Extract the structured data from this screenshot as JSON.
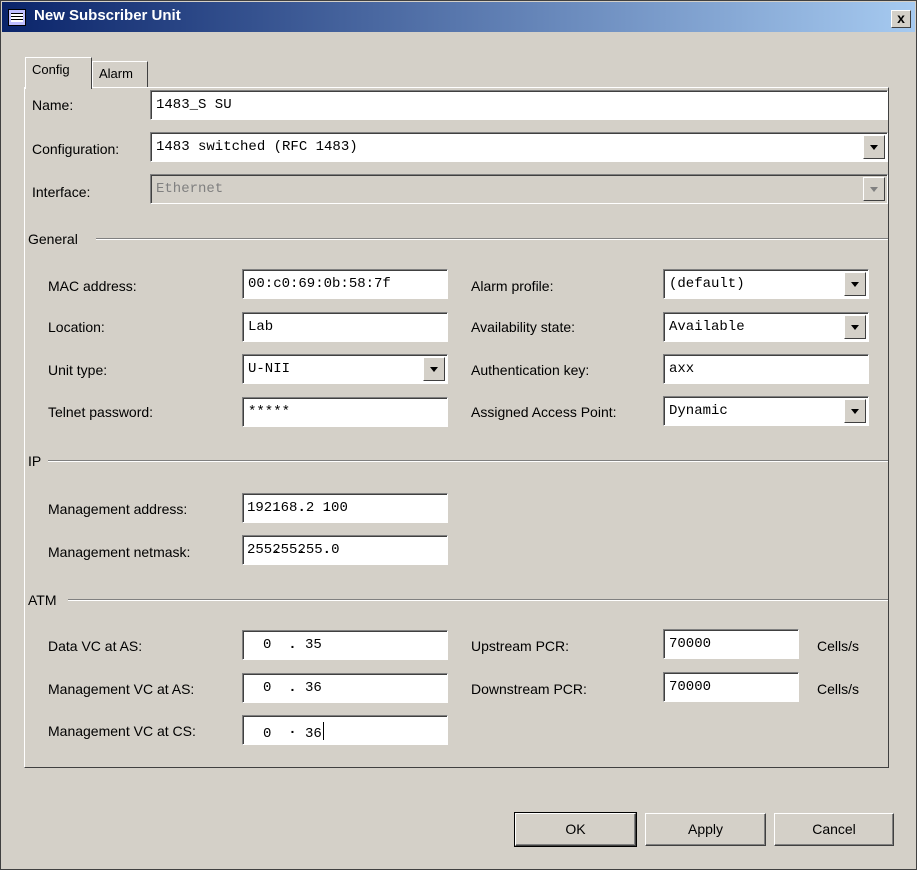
{
  "window": {
    "title": "New Subscriber Unit",
    "close_glyph": "x"
  },
  "tabs": [
    {
      "label": "Config"
    },
    {
      "label": "Alarm"
    }
  ],
  "top": {
    "name_label": "Name:",
    "name_value": "1483_S SU",
    "configuration_label": "Configuration:",
    "configuration_value": "1483 switched (RFC 1483)",
    "interface_label": "Interface:",
    "interface_value": "Ethernet"
  },
  "general": {
    "heading": "General",
    "mac_label": "MAC address:",
    "mac_value": "00:c0:69:0b:58:7f",
    "location_label": "Location:",
    "location_value": "Lab",
    "unit_type_label": "Unit type:",
    "unit_type_value": "U-NII",
    "telnet_label": "Telnet password:",
    "telnet_value": "*****",
    "alarm_profile_label": "Alarm profile:",
    "alarm_profile_value": "(default)",
    "availability_label": "Availability state:",
    "availability_value": "Available",
    "auth_key_label": "Authentication key:",
    "auth_key_value": "axx",
    "access_point_label": "Assigned Access Point:",
    "access_point_value": "Dynamic"
  },
  "ip": {
    "heading": "IP",
    "mgmt_address_label": "Management address:",
    "mgmt_address": [
      "192",
      "168",
      "2",
      "100"
    ],
    "mgmt_netmask_label": "Management netmask:",
    "mgmt_netmask": [
      "255",
      "255",
      "255",
      "0"
    ]
  },
  "atm": {
    "heading": "ATM",
    "data_vc_label": "Data VC at AS:",
    "data_vc": [
      "0",
      "35"
    ],
    "mgmt_vc_as_label": "Management VC at AS:",
    "mgmt_vc_as": [
      "0",
      "36"
    ],
    "mgmt_vc_cs_label": "Management VC at CS:",
    "mgmt_vc_cs": [
      "0",
      "36"
    ],
    "upstream_label": "Upstream PCR:",
    "upstream_value": "70000",
    "downstream_label": "Downstream PCR:",
    "downstream_value": "70000",
    "unit": "Cells/s"
  },
  "buttons": {
    "ok": "OK",
    "apply": "Apply",
    "cancel": "Cancel"
  },
  "icons": {
    "title": "window-icon",
    "close": "close-icon",
    "dropdown": "chevron-down-icon"
  }
}
